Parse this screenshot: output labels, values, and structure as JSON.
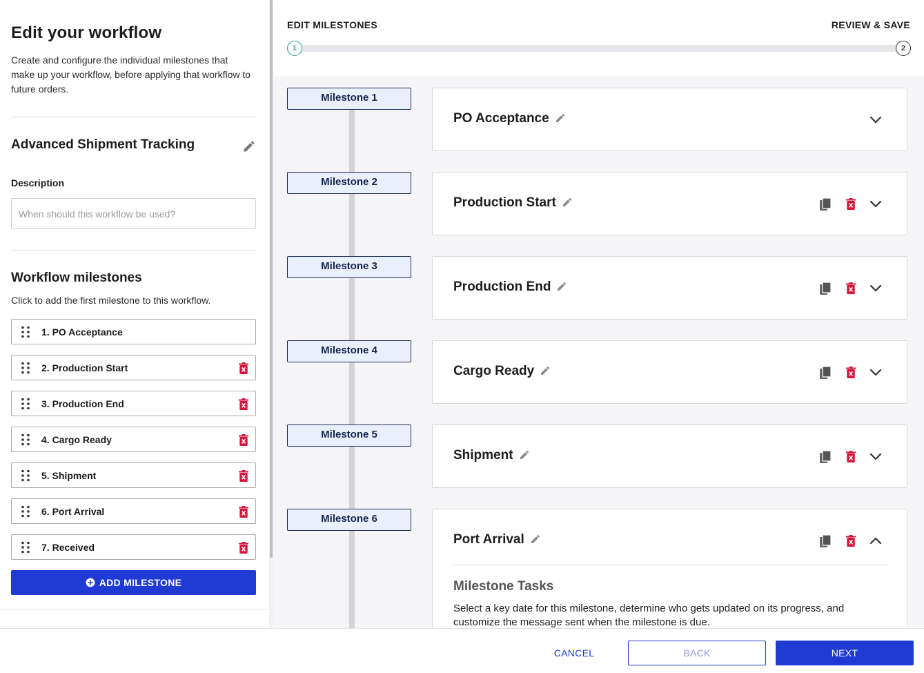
{
  "left": {
    "title": "Edit your workflow",
    "intro": "Create and configure the individual milestones that make up your workflow, before applying that workflow to future orders.",
    "workflow_name": "Advanced Shipment Tracking",
    "description_label": "Description",
    "description_placeholder": "When should this workflow be used?",
    "description_value": "",
    "milestones_title": "Workflow milestones",
    "milestones_subtitle": "Click to add the first milestone to this workflow.",
    "milestones": [
      {
        "label": "1. PO Acceptance",
        "deletable": false
      },
      {
        "label": "2. Production Start",
        "deletable": true
      },
      {
        "label": "3. Production End",
        "deletable": true
      },
      {
        "label": "4. Cargo Ready",
        "deletable": true
      },
      {
        "label": "5. Shipment",
        "deletable": true
      },
      {
        "label": "6. Port Arrival",
        "deletable": true
      },
      {
        "label": "7. Received",
        "deletable": true
      }
    ],
    "add_button": "ADD MILESTONE"
  },
  "stepper": {
    "steps": [
      {
        "label": "EDIT MILESTONES",
        "number": "1",
        "active": true
      },
      {
        "label": "REVIEW & SAVE",
        "number": "2",
        "active": false
      }
    ]
  },
  "cards": [
    {
      "tag": "Milestone 1",
      "title": "PO Acceptance",
      "actions": false,
      "expanded": false
    },
    {
      "tag": "Milestone 2",
      "title": "Production Start",
      "actions": true,
      "expanded": false
    },
    {
      "tag": "Milestone 3",
      "title": "Production End",
      "actions": true,
      "expanded": false
    },
    {
      "tag": "Milestone 4",
      "title": "Cargo Ready",
      "actions": true,
      "expanded": false
    },
    {
      "tag": "Milestone 5",
      "title": "Shipment",
      "actions": true,
      "expanded": false
    },
    {
      "tag": "Milestone 6",
      "title": "Port Arrival",
      "actions": true,
      "expanded": true,
      "tasks_title": "Milestone Tasks",
      "tasks_desc": "Select a key date for this milestone, determine who gets updated on its progress, and customize the message sent when the milestone is due."
    }
  ],
  "footer": {
    "cancel": "CANCEL",
    "back": "BACK",
    "next": "NEXT"
  },
  "colors": {
    "primary": "#1f3bd4",
    "danger": "#d6173d",
    "step_active": "#2aa386",
    "tag_bg": "#eaf0fb",
    "tag_border": "#1c2a55"
  },
  "icons": {
    "edit": "pencil-icon",
    "delete": "trash-icon",
    "copy": "copy-icon",
    "drag": "drag-handle-icon",
    "expand": "chevron-down-icon",
    "collapse": "chevron-up-icon",
    "add": "plus-circle-icon"
  }
}
